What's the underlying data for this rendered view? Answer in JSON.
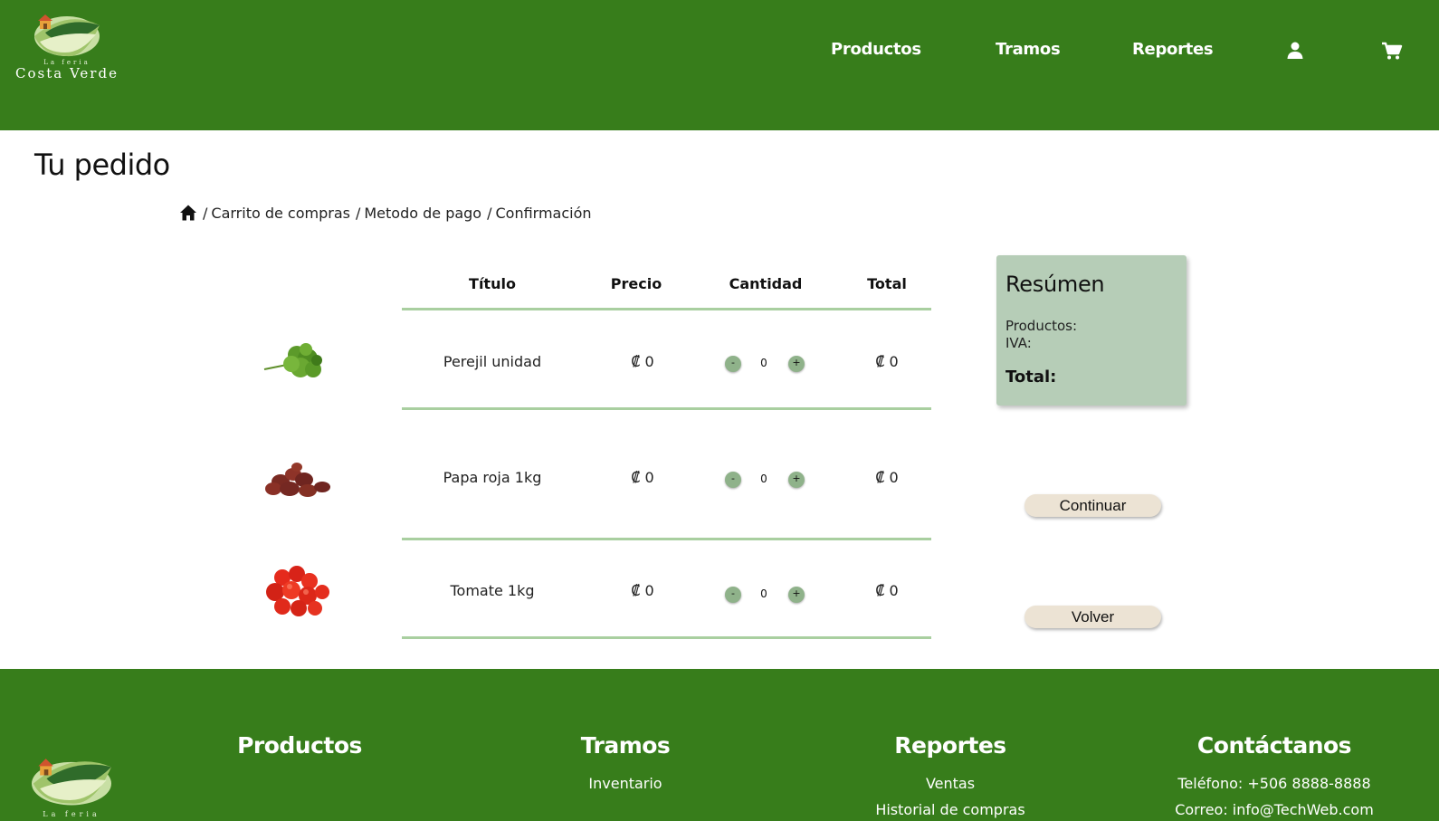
{
  "brand": {
    "small_text": "La feria",
    "name": "Costa Verde"
  },
  "nav": {
    "items": [
      {
        "label": "Productos"
      },
      {
        "label": "Tramos"
      },
      {
        "label": "Reportes"
      }
    ],
    "user_icon": "user-icon",
    "cart_icon": "cart-icon"
  },
  "page": {
    "title": "Tu pedido"
  },
  "breadcrumb": {
    "home_icon": "home-icon",
    "items": [
      "Carrito de compras",
      "Metodo de pago",
      "Confirmación"
    ]
  },
  "table": {
    "headers": [
      "Título",
      "Precio",
      "Cantidad",
      "Total"
    ],
    "rows": [
      {
        "image": "parsley-image",
        "title": "Perejil unidad",
        "price": "₡ 0",
        "quantity": "0",
        "total": "₡ 0"
      },
      {
        "image": "red-potato-image",
        "title": "Papa roja 1kg",
        "price": "₡ 0",
        "quantity": "0",
        "total": "₡ 0"
      },
      {
        "image": "tomato-image",
        "title": "Tomate 1kg",
        "price": "₡ 0",
        "quantity": "0",
        "total": "₡ 0"
      }
    ],
    "minus_label": "-",
    "plus_label": "+"
  },
  "summary": {
    "title": "Resúmen",
    "products_label": "Productos:",
    "iva_label": "IVA:",
    "total_label": "Total:"
  },
  "actions": {
    "continue_label": "Continuar",
    "back_label": "Volver"
  },
  "footer": {
    "logo_text": "La feria",
    "columns": [
      {
        "heading": "Productos",
        "links": []
      },
      {
        "heading": "Tramos",
        "links": [
          "Inventario"
        ]
      },
      {
        "heading": "Reportes",
        "links": [
          "Ventas",
          "Historial de compras"
        ]
      },
      {
        "heading": "Contáctanos",
        "links": [
          "Teléfono: +506 8888-8888",
          "Correo: info@TechWeb.com"
        ]
      }
    ]
  },
  "colors": {
    "header_green": "#377d1b",
    "summary_bg": "#b6cdb7",
    "divider": "#a9cfa0",
    "button_bg": "#ece3d4"
  }
}
